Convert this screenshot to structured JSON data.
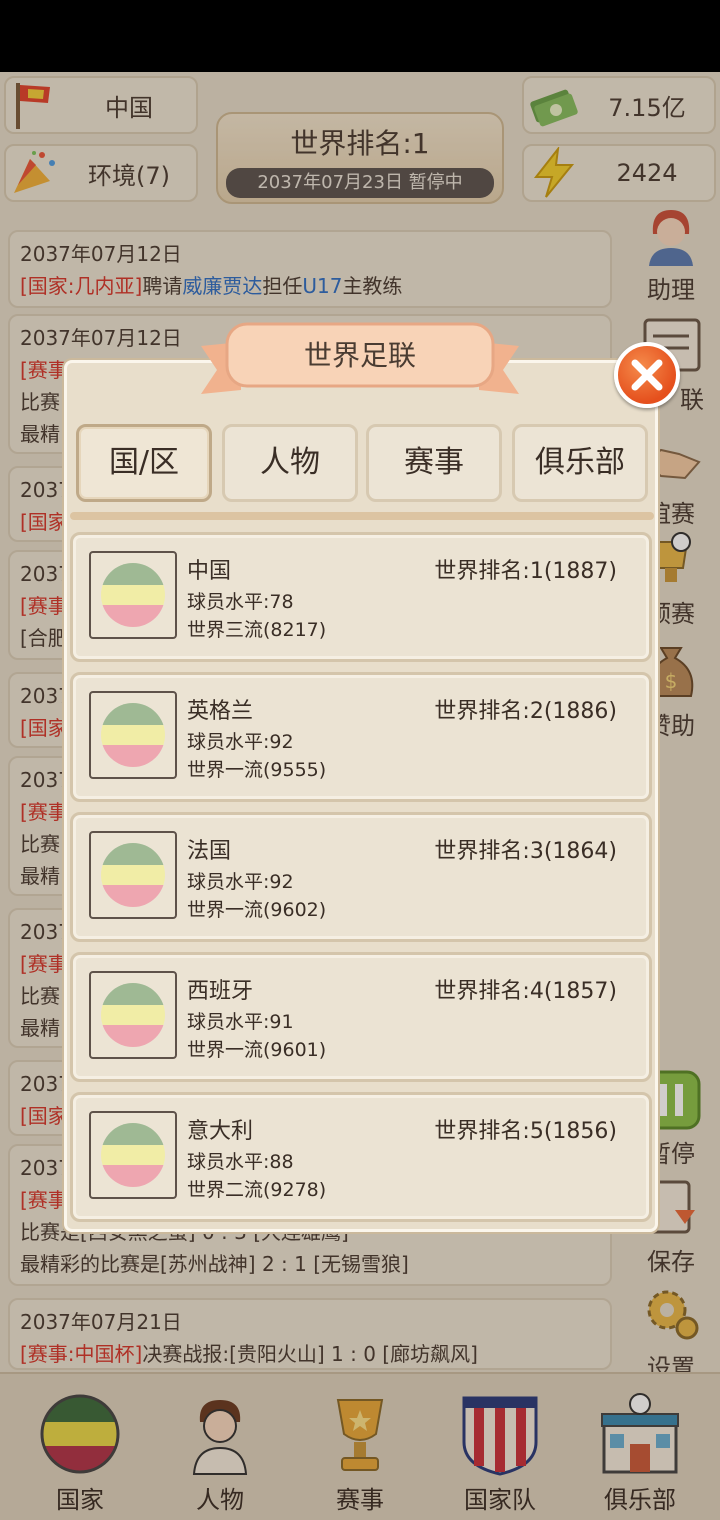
{
  "header": {
    "country": "中国",
    "environment": "环境(7)",
    "money": "7.15亿",
    "energy": "2424",
    "world_rank": "世界排名:1",
    "date_status": "2037年07月23日 暂停中"
  },
  "news": [
    {
      "date": "2037年07月12日",
      "tag": "[国家:几内亚]",
      "pre": "聘请",
      "person": "威廉贾达",
      "mid": "担任",
      "team": "U17",
      "post": "主教练"
    },
    {
      "date": "2037年07月12日",
      "line2": "[赛事",
      "line3": "比赛",
      "line4": "最精"
    },
    {
      "date": "2037",
      "line2": "[国家"
    },
    {
      "date": "2037",
      "line2": "[赛事",
      "line3": "[合肥"
    },
    {
      "date": "2037",
      "line2": "[国家"
    },
    {
      "date": "2037",
      "line2": "[赛事",
      "line3": "比赛",
      "line4": "最精"
    },
    {
      "date": "2037",
      "line2": "[赛事",
      "line3": "比赛",
      "line4": "最精"
    },
    {
      "date": "2037",
      "line2": "[国家"
    },
    {
      "date": "2037",
      "line2": "[赛事",
      "line3": "比赛是[西安黑之蛋] 0 : 3 [大连雄鹰]",
      "line4": "最精彩的比赛是[苏州战神] 2 : 1 [无锡雪狼]"
    },
    {
      "date": "2037年07月21日",
      "tag": "[赛事:中国杯]",
      "post": "决赛战报:[贵阳火山] 1 : 0 [廊坊飙风]"
    }
  ],
  "side_menu": [
    "助理",
    "联",
    "谊赛",
    "预赛",
    "赞助",
    "暂停",
    "保存",
    "设置"
  ],
  "bottom_nav": [
    "国家",
    "人物",
    "赛事",
    "国家队",
    "俱乐部"
  ],
  "modal": {
    "title": "世界足联",
    "tabs": [
      "国/区",
      "人物",
      "赛事",
      "俱乐部"
    ],
    "active_tab": 0,
    "rows": [
      {
        "name": "中国",
        "rank": "世界排名:1(1887)",
        "level": "球员水平:78",
        "tier": "世界三流(8217)"
      },
      {
        "name": "英格兰",
        "rank": "世界排名:2(1886)",
        "level": "球员水平:92",
        "tier": "世界一流(9555)"
      },
      {
        "name": "法国",
        "rank": "世界排名:3(1864)",
        "level": "球员水平:92",
        "tier": "世界一流(9602)"
      },
      {
        "name": "西班牙",
        "rank": "世界排名:4(1857)",
        "level": "球员水平:91",
        "tier": "世界一流(9601)"
      },
      {
        "name": "意大利",
        "rank": "世界排名:5(1856)",
        "level": "球员水平:88",
        "tier": "世界二流(9278)"
      }
    ]
  },
  "colors": {
    "accent_red": "#d5372c",
    "accent_blue": "#2f6fc4",
    "flag_green": "#9fb994",
    "flag_yellow": "#f1eda6",
    "flag_pink": "#eea6b0",
    "close_orange": "#e5501d"
  }
}
